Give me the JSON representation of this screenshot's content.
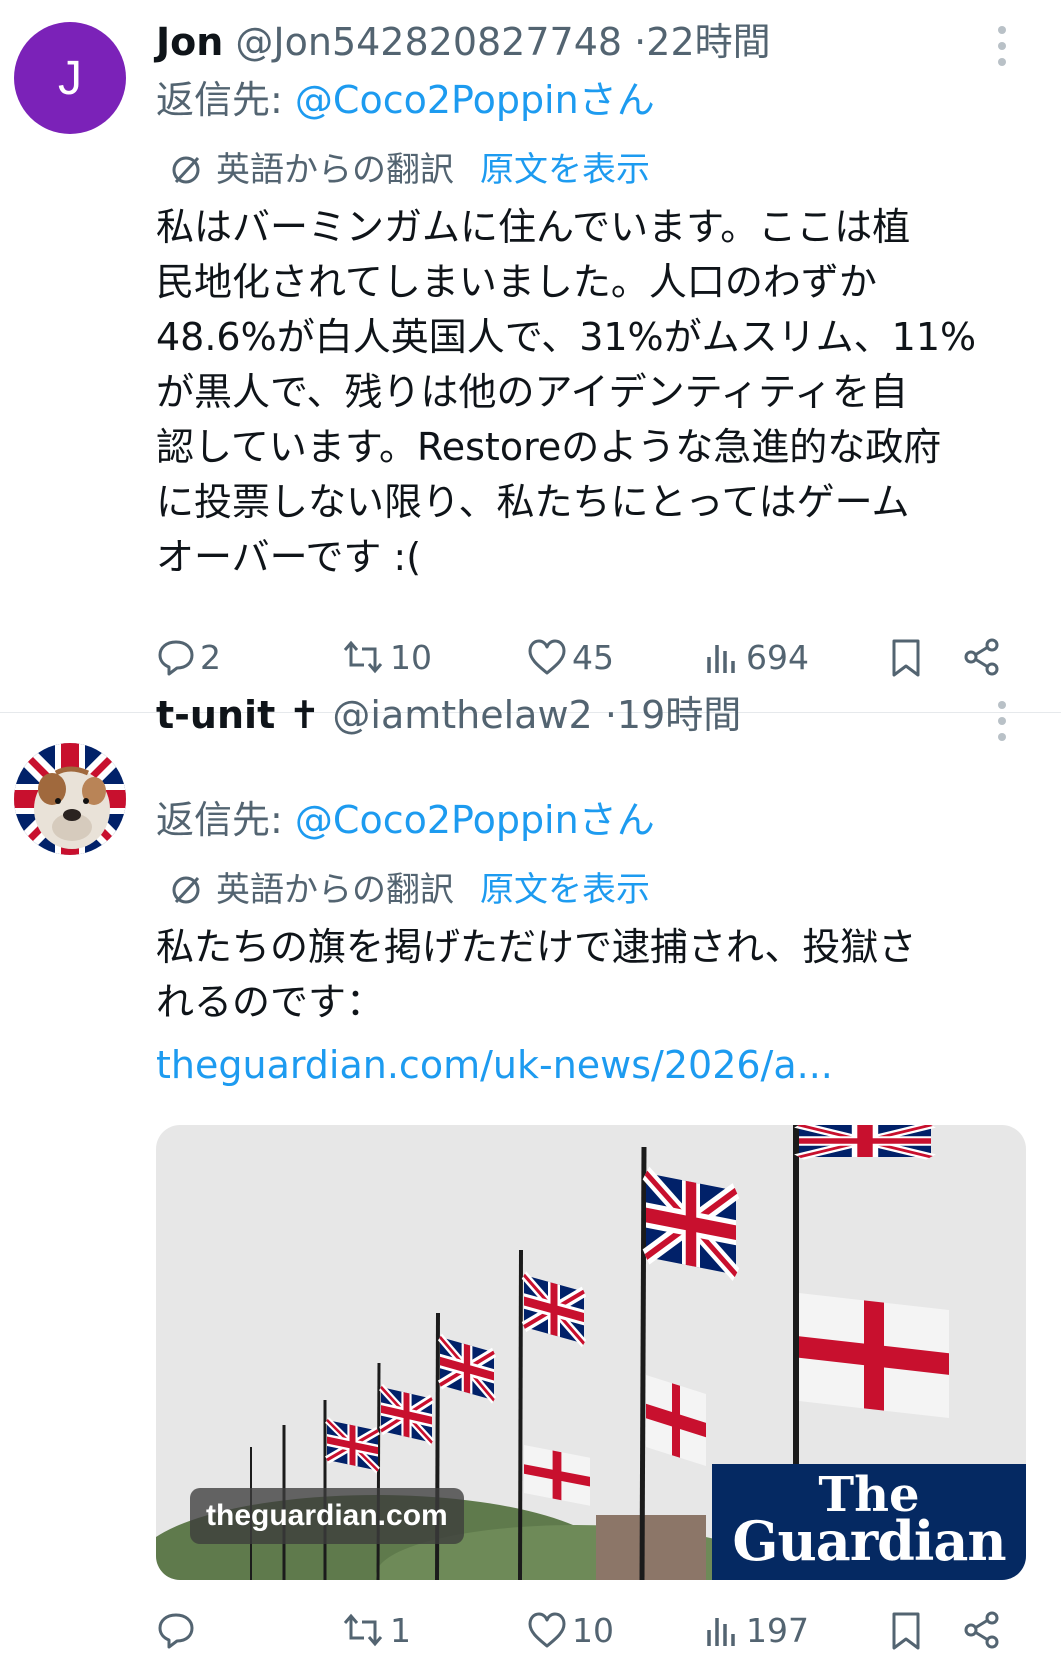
{
  "tweets": [
    {
      "avatar_letter": "J",
      "name": "Jon",
      "handle": "@Jon542820827748",
      "separator": "·",
      "time": "22時間",
      "reply_prefix": "返信先:",
      "reply_mention": "@Coco2Poppin",
      "reply_suffix": "さん",
      "translated_from": "英語からの翻訳",
      "show_original": "原文を表示",
      "text": "私はバーミンガムに住んでいます。ここは植\n民地化されてしまいました。人口のわずか\n48.6%が白人英国人で、31%がムスリム、11%\nが黒人で、残りは他のアイデンティティを自\n認しています。Restoreのような急進的な政府\nに投票しない限り、私たちにとってはゲーム\nオーバーです :(",
      "replies": "2",
      "reposts": "10",
      "likes": "45",
      "views": "694"
    },
    {
      "name": "t-unit ✝",
      "handle": "@iamthelaw2",
      "separator": "·",
      "time": "19時間",
      "reply_prefix": "返信先:",
      "reply_mention": "@Coco2Poppin",
      "reply_suffix": "さん",
      "translated_from": "英語からの翻訳",
      "show_original": "原文を表示",
      "text": "私たちの旗を掲げただけで逮捕され、投獄さ\nれるのです：",
      "link": "theguardian.com/uk-news/2026/a...",
      "card_domain": "theguardian.com",
      "card_logo_line1": "The",
      "card_logo_line2": "Guardian",
      "replies": "",
      "reposts": "1",
      "likes": "10",
      "views": "197"
    }
  ],
  "colors": {
    "accent": "#1d9bf0",
    "secondary_text": "#536471",
    "avatar_purple": "#7b22b8",
    "guardian_blue": "#052962"
  },
  "icons": [
    "more-icon",
    "translate-icon",
    "reply-icon",
    "repost-icon",
    "like-icon",
    "views-icon",
    "bookmark-icon",
    "share-icon"
  ]
}
